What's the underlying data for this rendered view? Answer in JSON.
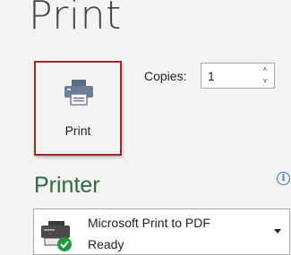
{
  "page_title": "Print",
  "print_button": {
    "label": "Print",
    "icon": "printer-icon"
  },
  "copies": {
    "label": "Copies:",
    "value": "1",
    "up_glyph": "˄",
    "down_glyph": "˅"
  },
  "printer_section": {
    "title": "Printer",
    "info_glyph": "i",
    "selected_printer": {
      "name": "Microsoft Print to PDF",
      "status": "Ready",
      "icon": "printer-ready-icon"
    }
  },
  "colors": {
    "accent_border": "#a5262a",
    "section_title": "#2e6a3c",
    "info": "#2f74c0",
    "ready_badge": "#1e9a3c"
  }
}
